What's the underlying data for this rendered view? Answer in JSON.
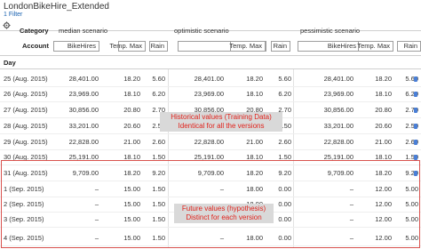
{
  "header": {
    "title": "LondonBikeHire_Extended",
    "filter_label": "1 Filter"
  },
  "table": {
    "category_label": "Category",
    "account_label": "Account",
    "day_label": "Day",
    "scenarios": [
      "median scenario",
      "optimistic scenario",
      "pessimistic scenario"
    ],
    "measures": [
      "BikeHires",
      "Temp. Max",
      "Rain"
    ],
    "rows": [
      {
        "day": "25 (Aug. 2015)",
        "values": [
          "28,401.00",
          "18.20",
          "5.60",
          "28,401.00",
          "18.20",
          "5.60",
          "28,401.00",
          "18.20",
          "5.60"
        ]
      },
      {
        "day": "26 (Aug. 2015)",
        "values": [
          "23,969.00",
          "18.10",
          "6.20",
          "23,969.00",
          "18.10",
          "6.20",
          "23,969.00",
          "18.10",
          "6.20"
        ]
      },
      {
        "day": "27 (Aug. 2015)",
        "values": [
          "30,856.00",
          "20.80",
          "2.70",
          "30,856.00",
          "20.80",
          "2.70",
          "30,856.00",
          "20.80",
          "2.70"
        ]
      },
      {
        "day": "28 (Aug. 2015)",
        "values": [
          "33,201.00",
          "20.60",
          "2.50",
          "33,201.00",
          "20.60",
          "2.50",
          "33,201.00",
          "20.60",
          "2.50"
        ]
      },
      {
        "day": "29 (Aug. 2015)",
        "values": [
          "22,828.00",
          "21.00",
          "2.60",
          "22,828.00",
          "21.00",
          "2.60",
          "22,828.00",
          "21.00",
          "2.60"
        ]
      },
      {
        "day": "30 (Aug. 2015)",
        "values": [
          "25,191.00",
          "18.10",
          "1.50",
          "25,191.00",
          "18.10",
          "1.50",
          "25,191.00",
          "18.10",
          "1.50"
        ]
      },
      {
        "day": "31 (Aug. 2015)",
        "values": [
          "9,709.00",
          "18.20",
          "9.20",
          "9,709.00",
          "18.20",
          "9.20",
          "9,709.00",
          "18.20",
          "9.20"
        ]
      },
      {
        "day": "1 (Sep. 2015)",
        "values": [
          "–",
          "15.00",
          "1.50",
          "–",
          "18.00",
          "0.00",
          "–",
          "12.00",
          "5.00"
        ]
      },
      {
        "day": "2 (Sep. 2015)",
        "values": [
          "–",
          "15.00",
          "1.50",
          "–",
          "18.00",
          "0.00",
          "–",
          "12.00",
          "5.00"
        ]
      },
      {
        "day": "3 (Sep. 2015)",
        "values": [
          "–",
          "15.00",
          "1.50",
          "–",
          "18.00",
          "0.00",
          "–",
          "12.00",
          "5.00"
        ]
      },
      {
        "day": "4 (Sep. 2015)",
        "values": [
          "–",
          "15.00",
          "1.50",
          "–",
          "18.00",
          "0.00",
          "–",
          "12.00",
          "5.00"
        ]
      }
    ]
  },
  "annotations": {
    "historical_line1": "Historical values (Training Data)",
    "historical_line2": "Identical for all the versions",
    "future_line1": "Future values (hypothesis)",
    "future_line2": "Distinct for each version"
  },
  "colors": {
    "highlight_border": "#d9534f",
    "annotation_text": "#e0221b",
    "annotation_bg": "#d9d9d9",
    "indicator_blue": "#4a7fd6"
  }
}
